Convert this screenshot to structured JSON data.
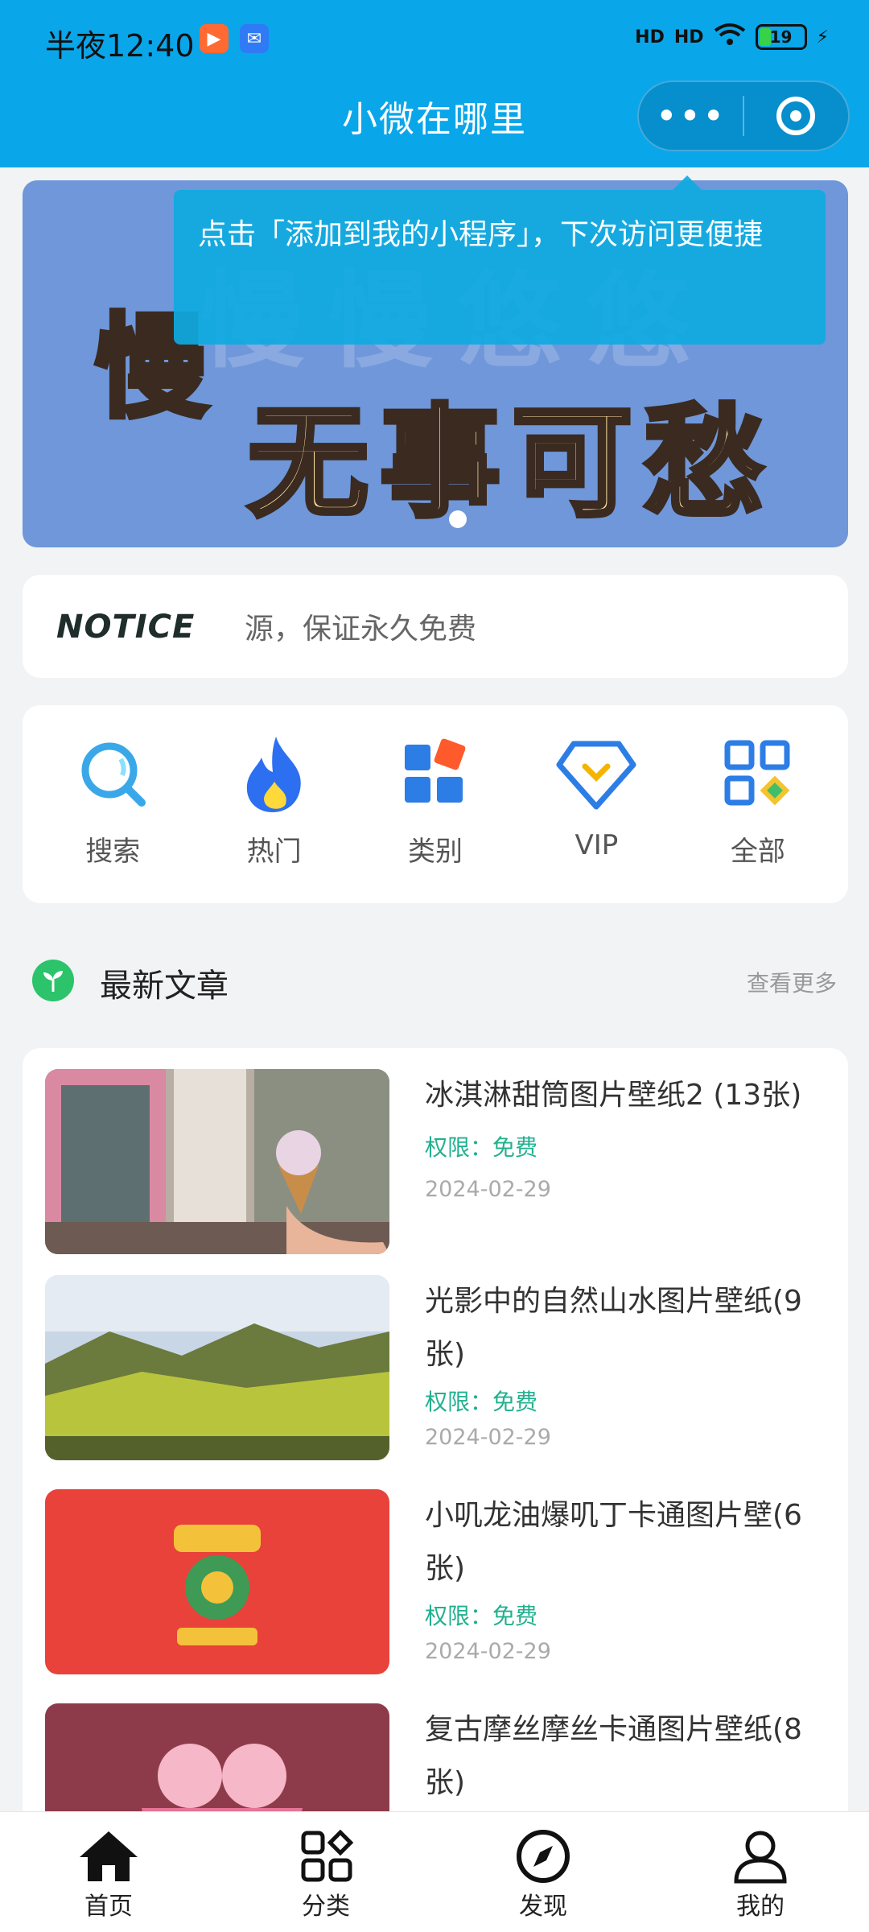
{
  "status_bar": {
    "time": "半夜12:40",
    "battery": "19",
    "signal_1": "HD",
    "signal_2": "HD"
  },
  "header": {
    "title": "小微在哪里",
    "more_icon": "more-dots-icon",
    "close_icon": "target-close-icon"
  },
  "banner": {
    "background_color": "#6f97d9",
    "line1": "慢",
    "line2": "无事可愁",
    "ghost": "慢慢悠悠"
  },
  "tooltip": {
    "text": "点击「添加到我的小程序」，下次访问更便捷"
  },
  "notice": {
    "logo_text": "NOTICE",
    "text": "源，保证永久免费"
  },
  "menu": [
    {
      "label": "搜索",
      "icon": "search-icon"
    },
    {
      "label": "热门",
      "icon": "flame-icon"
    },
    {
      "label": "类别",
      "icon": "category-icon"
    },
    {
      "label": "VIP",
      "icon": "vip-diamond-icon"
    },
    {
      "label": "全部",
      "icon": "grid-all-icon"
    }
  ],
  "section": {
    "title": "最新文章",
    "more": "查看更多"
  },
  "articles": [
    {
      "title": "冰淇淋甜筒图片壁纸2 (13张)",
      "permission": "权限：免费",
      "date": "2024-02-29"
    },
    {
      "title": "光影中的自然山水图片壁纸(9张)",
      "permission": "权限：免费",
      "date": "2024-02-29"
    },
    {
      "title": "小叽龙油爆叽丁卡通图片壁(6张)",
      "permission": "权限：免费",
      "date": "2024-02-29"
    },
    {
      "title": "复古摩丝摩丝卡通图片壁纸(8张)",
      "permission": "",
      "date": ""
    }
  ],
  "tabbar": [
    {
      "label": "首页",
      "icon": "home-icon"
    },
    {
      "label": "分类",
      "icon": "category-grid-icon"
    },
    {
      "label": "发现",
      "icon": "compass-icon"
    },
    {
      "label": "我的",
      "icon": "user-icon"
    }
  ],
  "colors": {
    "brand_blue": "#0aa6ea",
    "accent_green": "#22b08f"
  }
}
